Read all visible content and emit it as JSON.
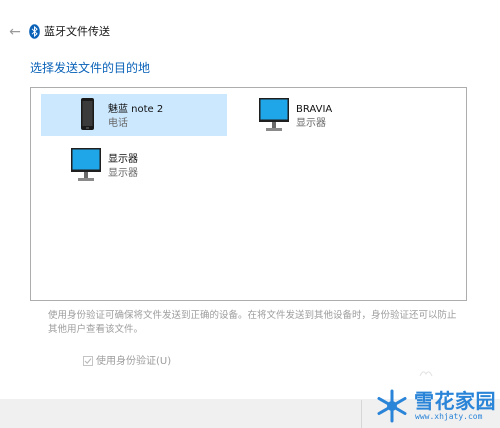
{
  "window": {
    "title": "蓝牙文件传送"
  },
  "page": {
    "heading": "选择发送文件的目的地"
  },
  "devices": [
    {
      "name": "魅蓝 note 2",
      "type": "电话",
      "icon": "phone-icon",
      "selected": true
    },
    {
      "name": "BRAVIA",
      "type": "显示器",
      "icon": "monitor-icon",
      "selected": false
    },
    {
      "name": "显示器",
      "type": "显示器",
      "icon": "monitor-icon",
      "selected": false
    }
  ],
  "info": {
    "text": "使用身份验证可确保将文件发送到正确的设备。在将文件发送到其他设备时，身份验证还可以防止其他用户查看该文件。"
  },
  "auth": {
    "label": "使用身份验证(U)",
    "checked": true,
    "disabled": true
  },
  "watermark": {
    "text": "雪花家园",
    "url": "www.xhjaty.com"
  },
  "colors": {
    "accent": "#0a62b8",
    "selected_bg": "#cce8ff",
    "screen_blue": "#1fa6e8"
  }
}
